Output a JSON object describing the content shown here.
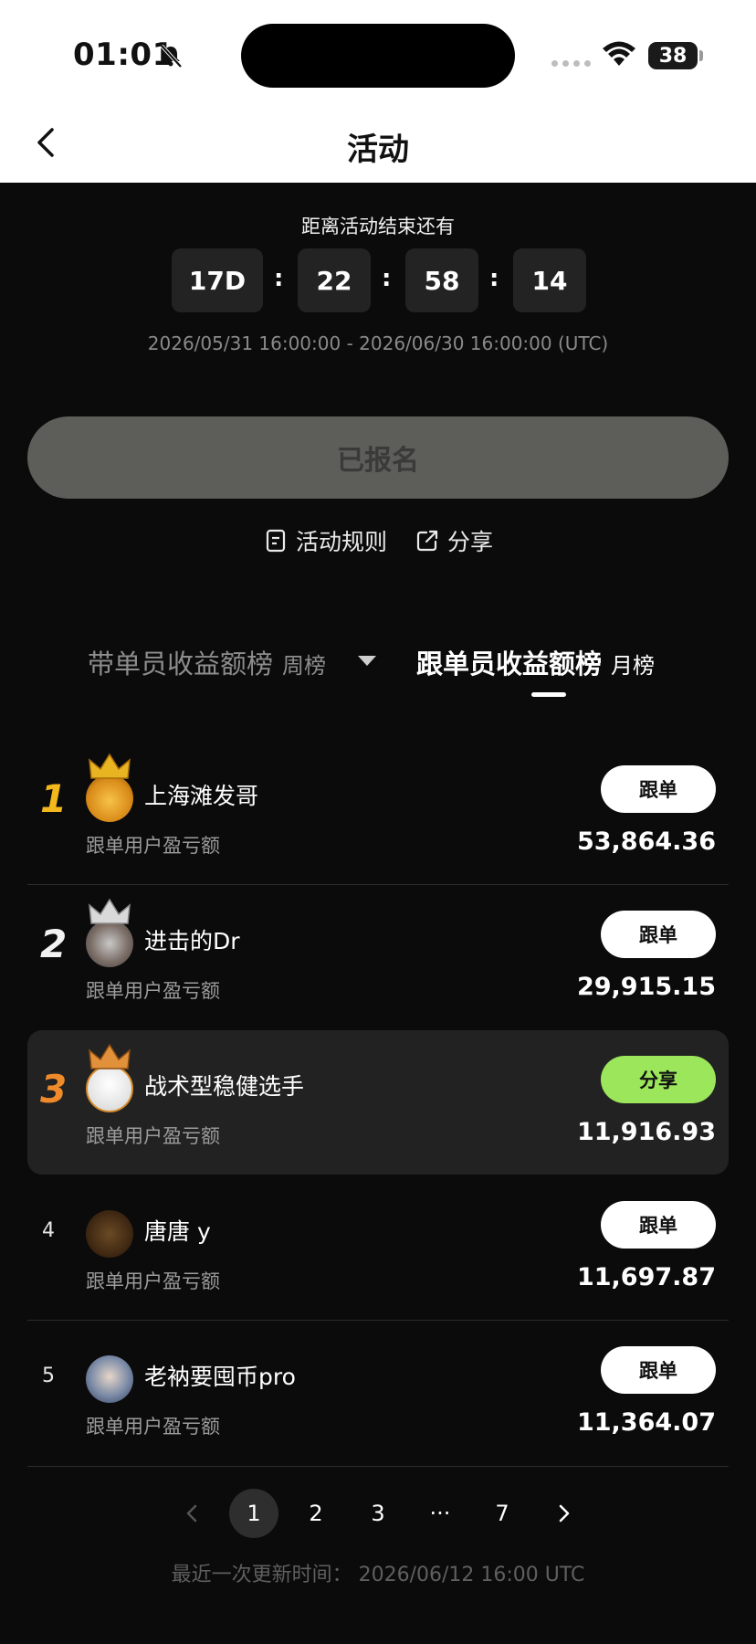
{
  "status_bar": {
    "time": "01:01",
    "battery": "38"
  },
  "header": {
    "title": "活动"
  },
  "countdown": {
    "label": "距离活动结束还有",
    "days": "17D",
    "hours": "22",
    "minutes": "58",
    "seconds": "14",
    "separator": ":",
    "range": "2026/05/31 16:00:00 - 2026/06/30 16:00:00 (UTC)"
  },
  "signup_button": "已报名",
  "links": {
    "rules": "活动规则",
    "share": "分享"
  },
  "tabs": [
    {
      "label": "带单员收益额榜",
      "sub": "周榜"
    },
    {
      "label": "跟单员收益额榜",
      "sub": "月榜"
    }
  ],
  "leaderboard": [
    {
      "rank": "1",
      "name": "上海滩发哥",
      "sublabel": "跟单用户盈亏额",
      "value": "53,864.36",
      "button": "跟单"
    },
    {
      "rank": "2",
      "name": "进击的Dr",
      "sublabel": "跟单用户盈亏额",
      "value": "29,915.15",
      "button": "跟单"
    },
    {
      "rank": "3",
      "name": "战术型稳健选手",
      "sublabel": "跟单用户盈亏额",
      "value": "11,916.93",
      "button": "分享"
    },
    {
      "rank": "4",
      "name": "唐唐 y",
      "sublabel": "跟单用户盈亏额",
      "value": "11,697.87",
      "button": "跟单"
    },
    {
      "rank": "5",
      "name": "老衲要囤币pro",
      "sublabel": "跟单用户盈亏额",
      "value": "11,364.07",
      "button": "跟单"
    }
  ],
  "pagination": {
    "pages": [
      "1",
      "2",
      "3",
      "···",
      "7"
    ],
    "current": "1"
  },
  "updated": "最近一次更新时间： 2026/06/12 16:00 UTC",
  "colors": {
    "accent_green": "#9be65b",
    "gold": "#f2b81c",
    "silver": "#f2f2f2",
    "bronze": "#ef8a2a"
  }
}
